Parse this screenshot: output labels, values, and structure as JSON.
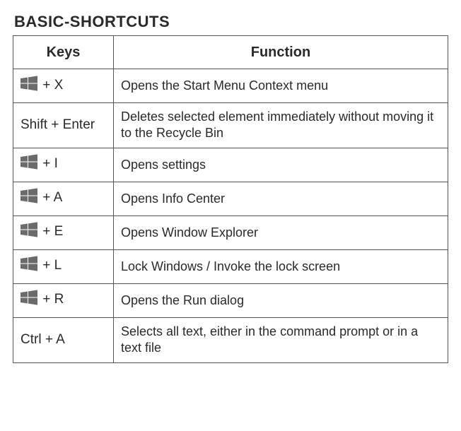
{
  "title": "BASIC-SHORTCUTS",
  "headers": {
    "keys": "Keys",
    "function": "Function"
  },
  "rows": [
    {
      "icon": "win",
      "keys_text": " + X",
      "function": "Opens the Start Menu Context menu"
    },
    {
      "icon": "",
      "keys_text": "Shift + Enter",
      "function": "Deletes selected element immediately without mo­ving it to the Recycle Bin"
    },
    {
      "icon": "win",
      "keys_text": " + I",
      "function": "Opens settings"
    },
    {
      "icon": "win",
      "keys_text": " + A",
      "function": "Opens Info Center"
    },
    {
      "icon": "win",
      "keys_text": " + E",
      "function": "Opens Window Explorer"
    },
    {
      "icon": "win",
      "keys_text": " + L",
      "function": "Lock Windows / Invoke the lock screen"
    },
    {
      "icon": "win",
      "keys_text": " + R",
      "function": "Opens the Run dialog"
    },
    {
      "icon": "",
      "keys_text": "Ctrl + A",
      "function": "Selects all text, either in the command prompt or in a text file"
    }
  ]
}
